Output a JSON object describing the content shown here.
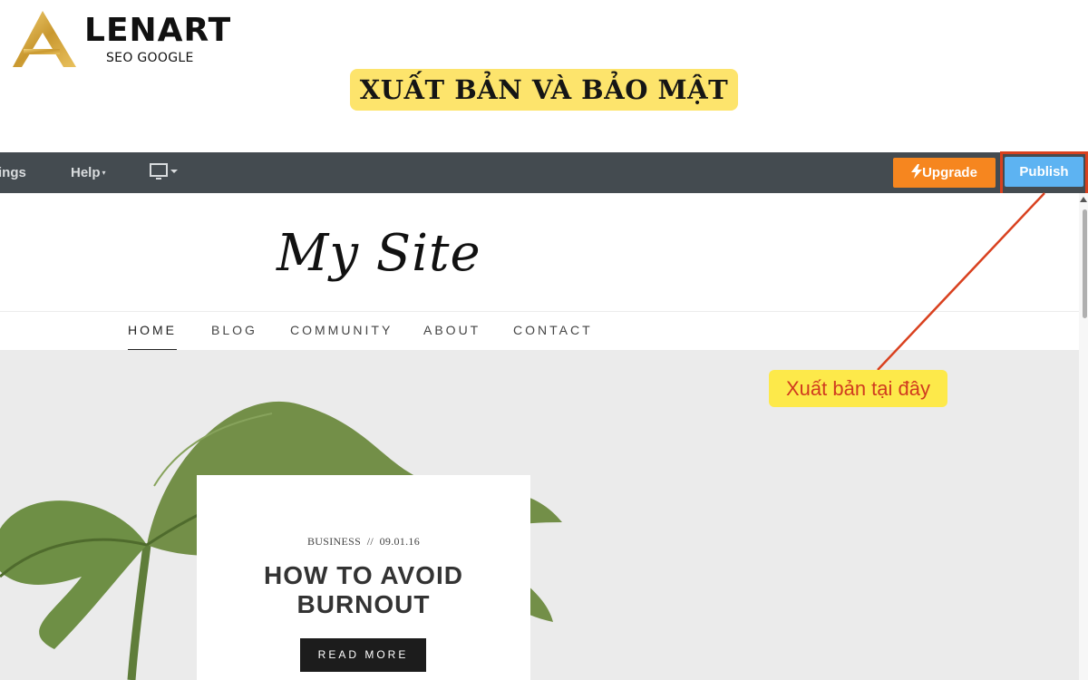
{
  "branding": {
    "logo_name": "LENART",
    "logo_sub": "SEO GOOGLE",
    "banner_title": "XUẤT BẢN VÀ BẢO MẬT"
  },
  "editor_toolbar": {
    "settings_label": "ings",
    "help_label": "Help",
    "caret": "▾",
    "device_icon": "monitor-icon",
    "upgrade_label": "Upgrade",
    "upgrade_icon": "lightning-icon",
    "publish_label": "Publish",
    "colors": {
      "bar": "#444b50",
      "upgrade": "#f6861f",
      "publish": "#5db3f2",
      "highlight": "#d9411f"
    }
  },
  "site": {
    "title": "My Site",
    "nav": [
      "HOME",
      "BLOG",
      "COMMUNITY",
      "ABOUT",
      "CONTACT"
    ],
    "active_nav": "HOME",
    "post": {
      "category": "BUSINESS",
      "separator": "//",
      "date": "09.01.16",
      "title_line1": "HOW TO AVOID",
      "title_line2": "BURNOUT",
      "button_label": "READ MORE"
    }
  },
  "annotation": {
    "callout_text": "Xuất bản tại đây",
    "callout_bg": "#fde94a",
    "callout_text_color": "#d03b1f"
  }
}
